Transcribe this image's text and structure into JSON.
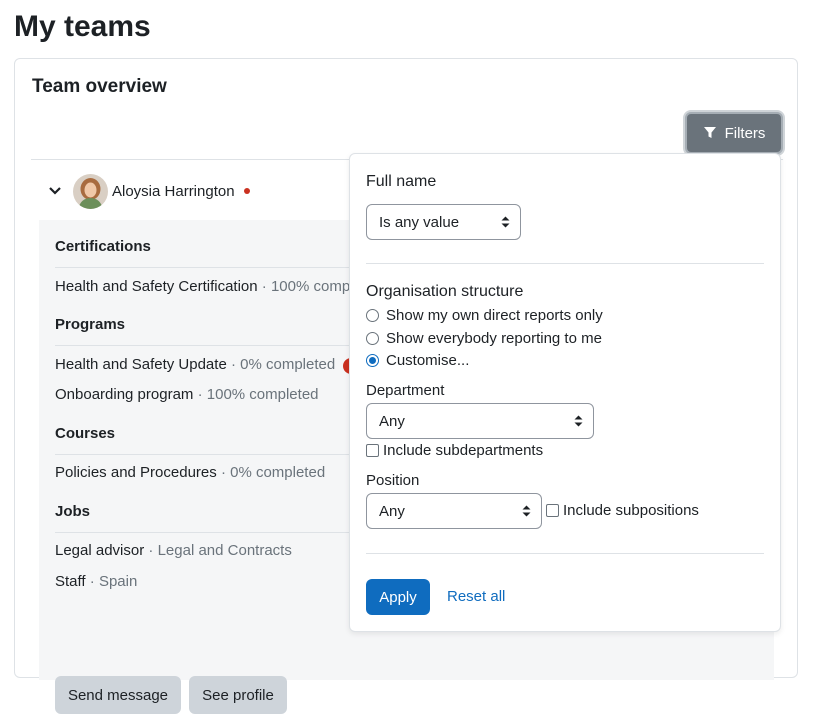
{
  "page": {
    "title": "My teams"
  },
  "card": {
    "title": "Team overview",
    "filters_label": "Filters",
    "member": {
      "name": "Aloysia Harrington"
    },
    "sections": {
      "certifications": {
        "heading": "Certifications",
        "items": [
          {
            "name": "Health and Safety Certification",
            "sep": "·",
            "status": "100% comp"
          }
        ]
      },
      "programs": {
        "heading": "Programs",
        "items": [
          {
            "name": "Health and Safety Update",
            "sep": "·",
            "status": "0% completed"
          },
          {
            "name": "Onboarding program",
            "sep": "·",
            "status": "100% completed"
          }
        ]
      },
      "courses": {
        "heading": "Courses",
        "items": [
          {
            "name": "Policies and Procedures",
            "sep": "·",
            "status": "0% completed"
          }
        ]
      },
      "jobs": {
        "heading": "Jobs",
        "items": [
          {
            "name": "Legal advisor",
            "sep": "·",
            "status": "Legal and Contracts"
          },
          {
            "name": "Staff",
            "sep": "·",
            "status": "Spain"
          }
        ]
      }
    },
    "actions": {
      "send_message": "Send message",
      "see_profile": "See profile"
    }
  },
  "filters": {
    "full_name": {
      "label": "Full name",
      "value": "Is any value"
    },
    "org": {
      "label": "Organisation structure",
      "options": [
        "Show my own direct reports only",
        "Show everybody reporting to me",
        "Customise..."
      ],
      "selected": "Customise..."
    },
    "department": {
      "label": "Department",
      "value": "Any",
      "include_label": "Include subdepartments"
    },
    "position": {
      "label": "Position",
      "value": "Any",
      "include_label": "Include subpositions"
    },
    "apply_label": "Apply",
    "reset_label": "Reset all"
  },
  "colors": {
    "primary": "#0f6cbf",
    "filter_button": "#6a737b",
    "danger": "#ca3120",
    "panel_bg": "#f5f6f7"
  },
  "icons": {
    "filter": "filter-icon",
    "chevron": "chevron-down-icon",
    "caret": "select-caret-icon"
  }
}
